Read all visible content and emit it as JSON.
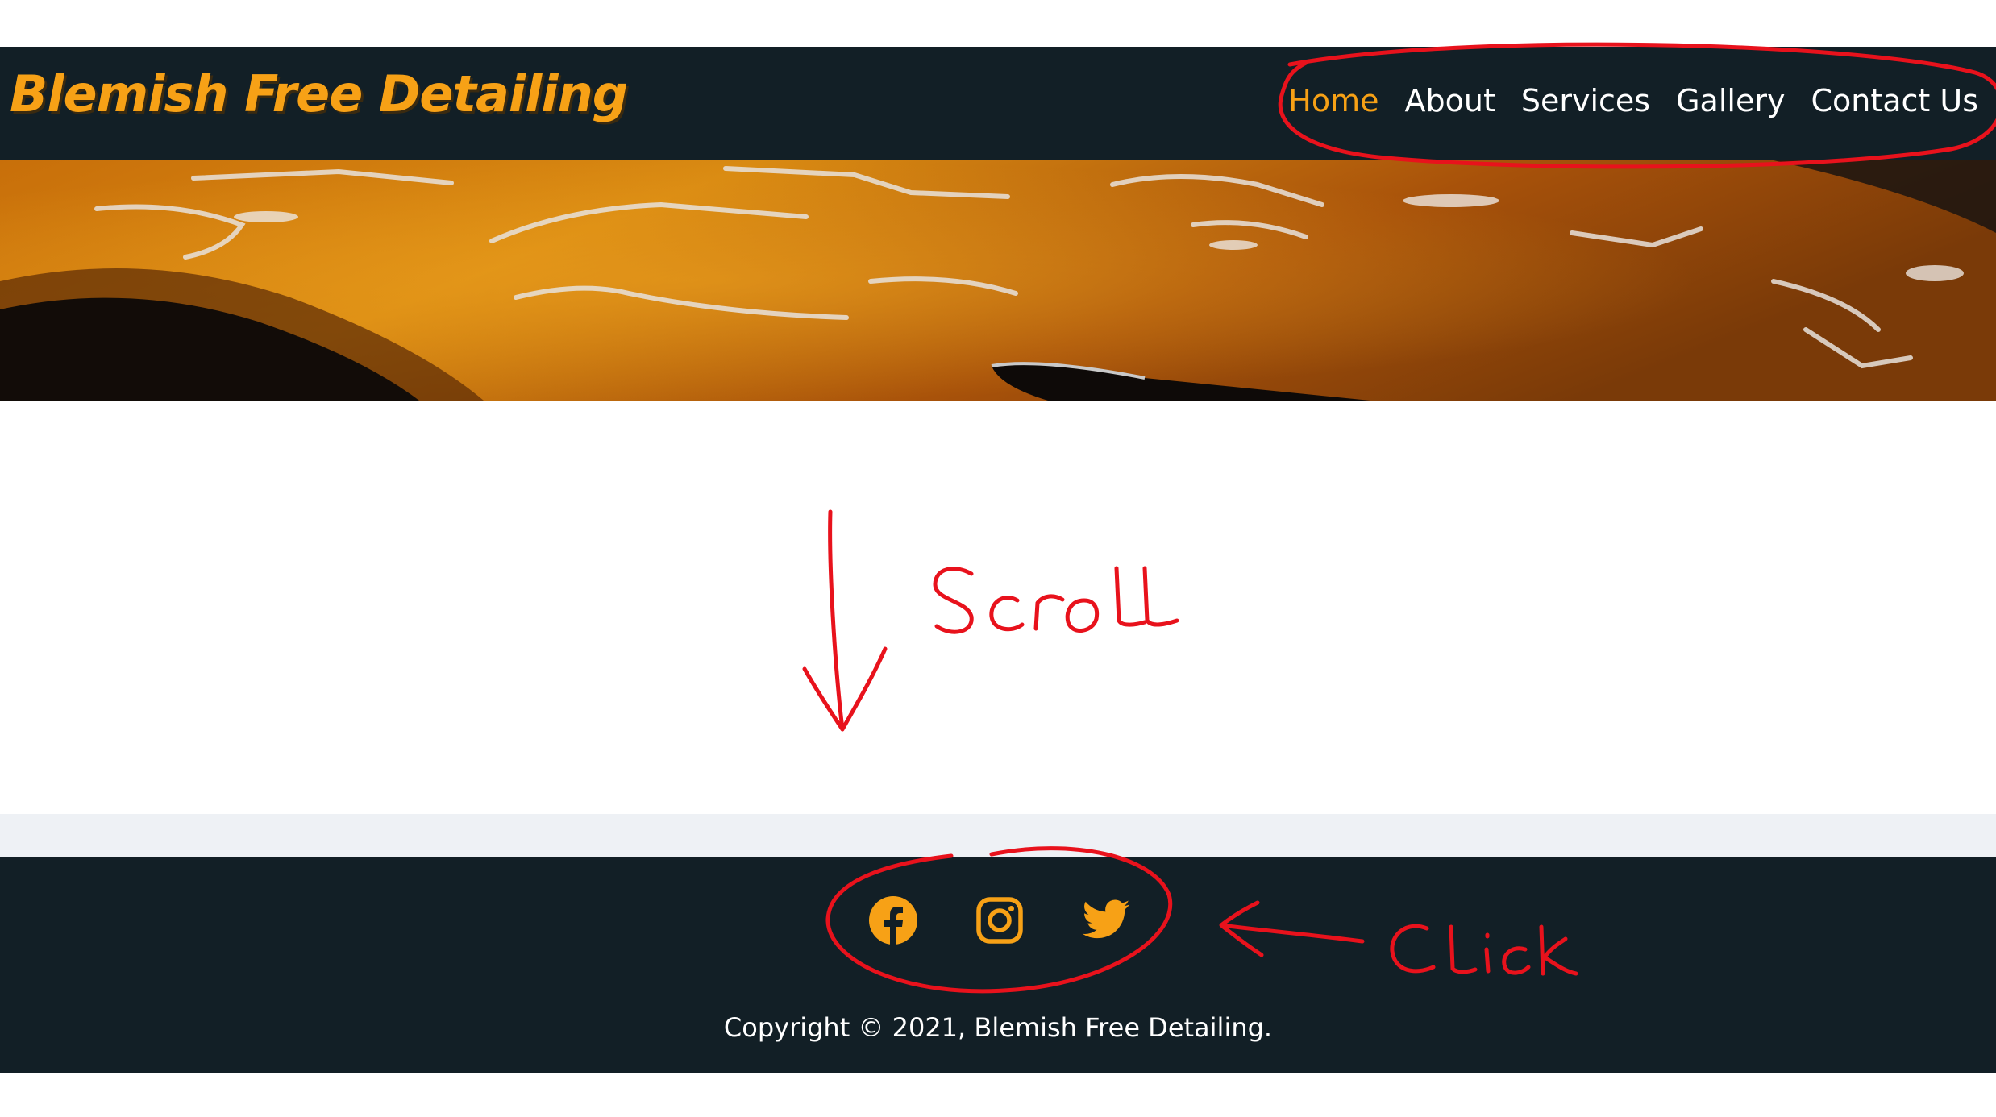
{
  "brand": {
    "name": "Blemish Free Detailing",
    "accent_color": "#f7a116",
    "dark_color": "#121f26"
  },
  "nav": {
    "items": [
      {
        "label": "Home",
        "active": true
      },
      {
        "label": "About",
        "active": false
      },
      {
        "label": "Services",
        "active": false
      },
      {
        "label": "Gallery",
        "active": false
      },
      {
        "label": "Contact Us",
        "active": false
      }
    ]
  },
  "hero": {
    "image": "orange-car-hood-photo"
  },
  "footer": {
    "socials": [
      {
        "icon": "facebook-icon"
      },
      {
        "icon": "instagram-icon"
      },
      {
        "icon": "twitter-icon"
      }
    ],
    "copyright": "Copyright © 2021, Blemish Free Detailing."
  },
  "annotations": {
    "scroll_label": "Scroll",
    "click_label": "Click",
    "color": "#e8121c"
  }
}
